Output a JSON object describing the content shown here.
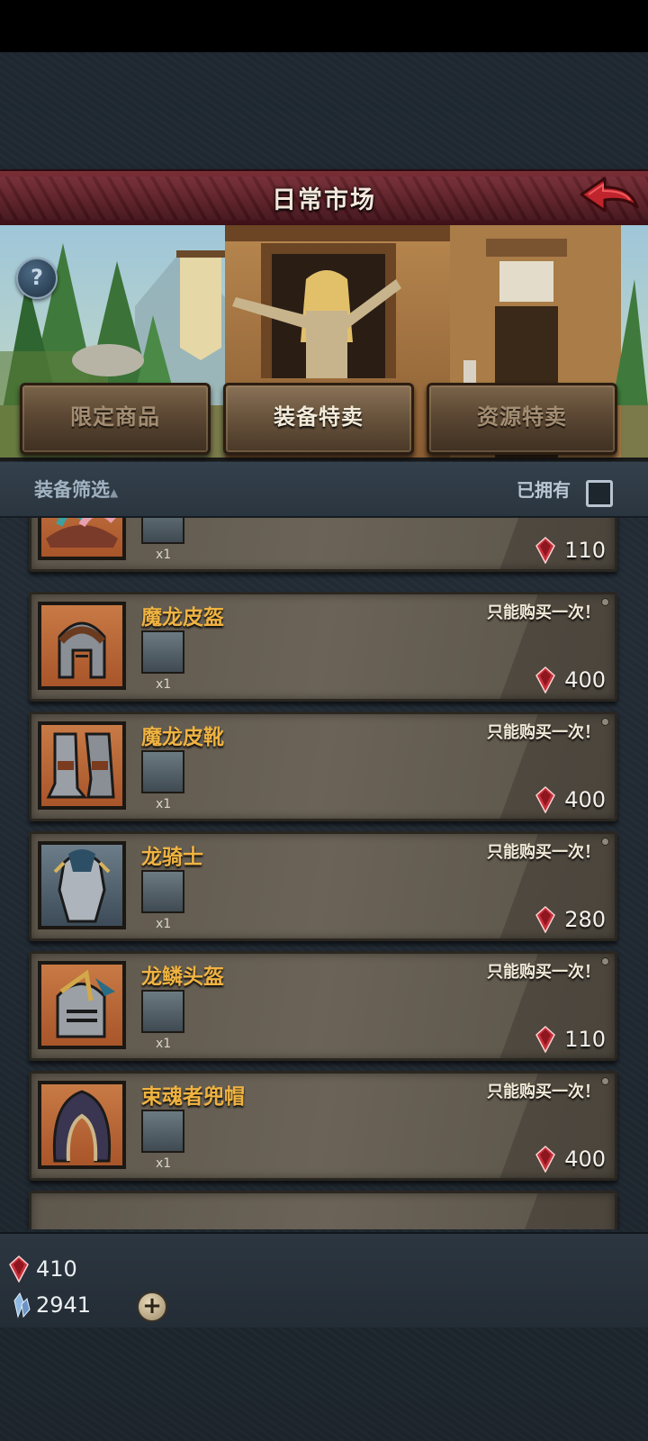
{
  "header": {
    "title": "日常市场"
  },
  "tabs": [
    {
      "label": "限定商品",
      "active": false
    },
    {
      "label": "装备特卖",
      "active": true
    },
    {
      "label": "资源特卖",
      "active": false
    }
  ],
  "filter": {
    "label": "装备筛选",
    "arrow": "▲",
    "owned_label": "已拥有",
    "owned_checked": false
  },
  "items": [
    {
      "name": "",
      "limit": "",
      "qty": "x1",
      "price": "110",
      "icon": "feathered-hat-icon"
    },
    {
      "name": "魔龙皮盔",
      "limit": "只能购买一次！",
      "qty": "x1",
      "price": "400",
      "icon": "helmet-icon"
    },
    {
      "name": "魔龙皮靴",
      "limit": "只能购买一次！",
      "qty": "x1",
      "price": "400",
      "icon": "boots-icon"
    },
    {
      "name": "龙骑士",
      "limit": "只能购买一次！",
      "qty": "x1",
      "price": "280",
      "icon": "dragon-knight-icon"
    },
    {
      "name": "龙鳞头盔",
      "limit": "只能购买一次！",
      "qty": "x1",
      "price": "110",
      "icon": "dragon-helmet-icon"
    },
    {
      "name": "束魂者兜帽",
      "limit": "只能购买一次！",
      "qty": "x1",
      "price": "400",
      "icon": "hood-icon"
    }
  ],
  "resources": {
    "rubies": "410",
    "crystals": "2941"
  },
  "colors": {
    "title_bar": "#5a1d25",
    "item_name": "#f0b341",
    "card": "#655e53",
    "ruby": "#c8303a"
  }
}
